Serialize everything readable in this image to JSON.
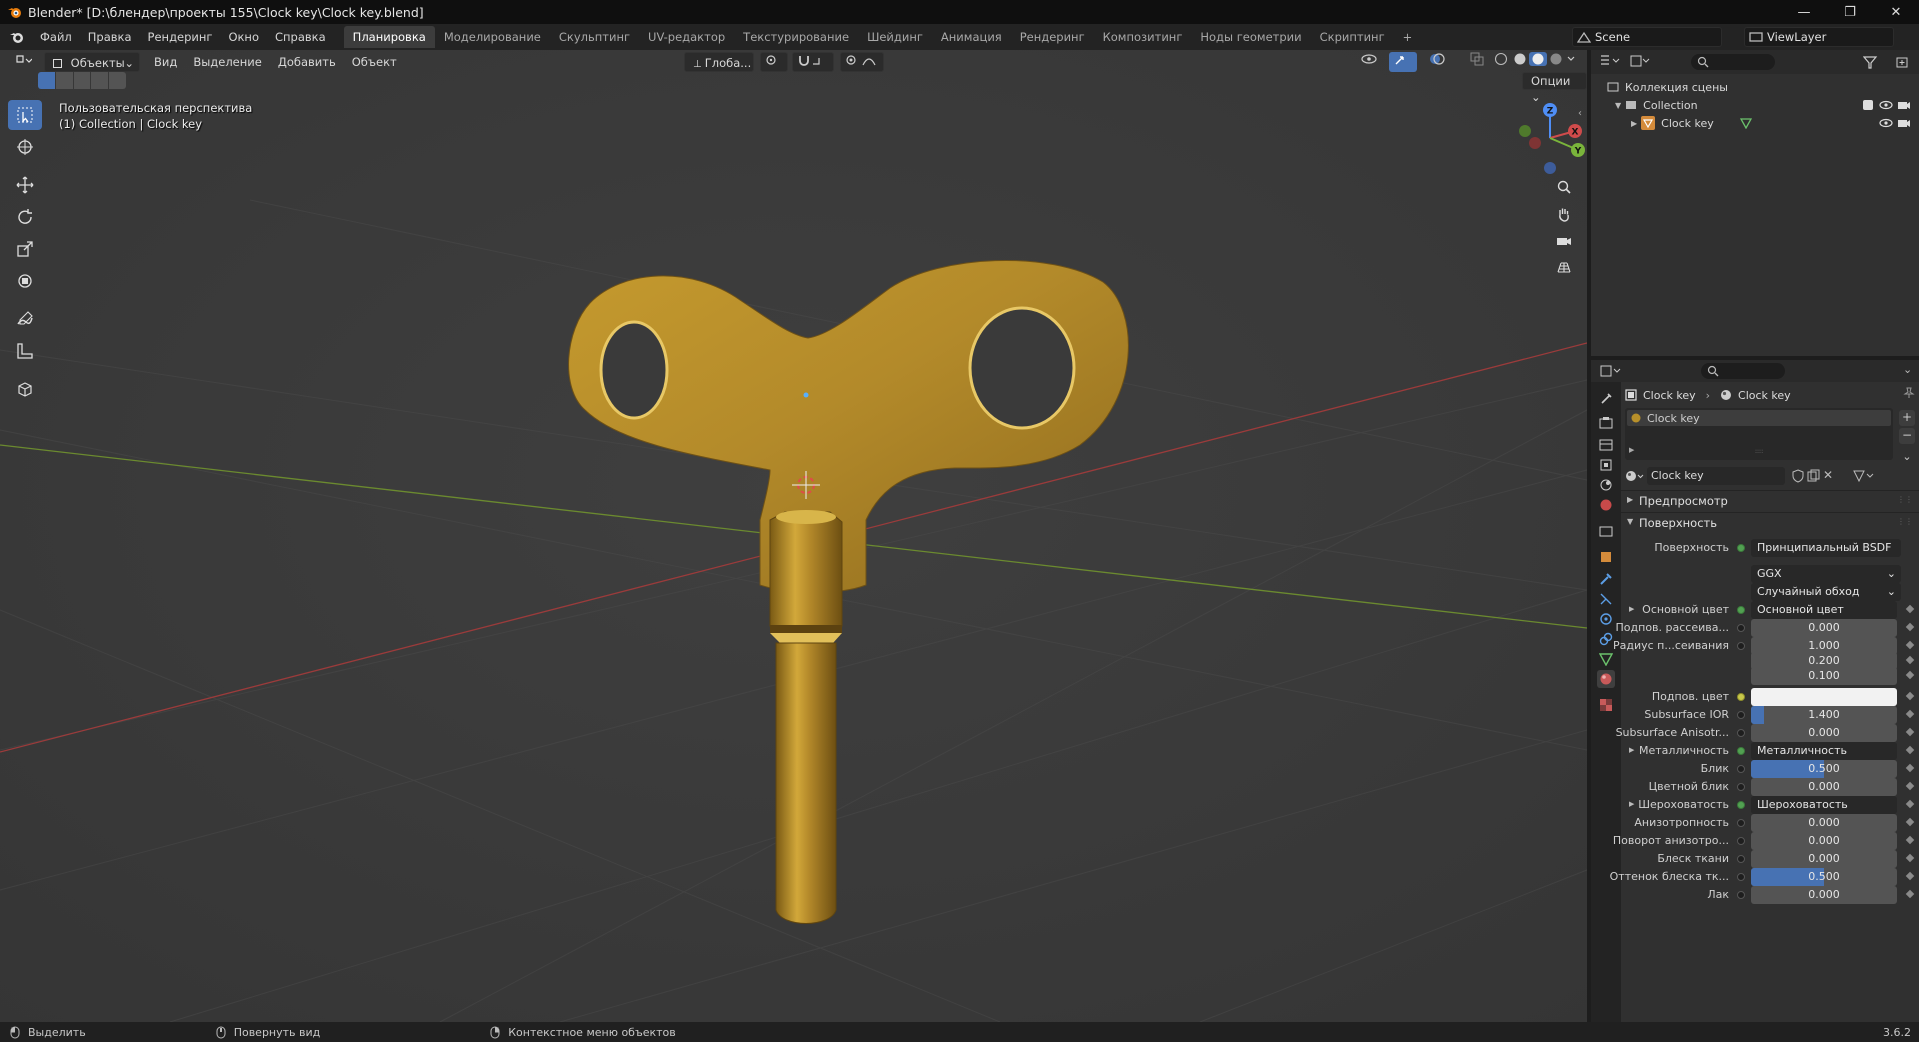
{
  "window": {
    "title": "Blender* [D:\\блендер\\проекты 155\\Clock key\\Clock key.blend]",
    "minimize": "—",
    "maximize": "❐",
    "close": "✕"
  },
  "menus": [
    "Файл",
    "Правка",
    "Рендеринг",
    "Окно",
    "Справка"
  ],
  "workspaces": [
    {
      "label": "Планировка",
      "active": true
    },
    {
      "label": "Моделирование"
    },
    {
      "label": "Скульптинг"
    },
    {
      "label": "UV-редактор"
    },
    {
      "label": "Текстурирование"
    },
    {
      "label": "Шейдинг"
    },
    {
      "label": "Анимация"
    },
    {
      "label": "Рендеринг"
    },
    {
      "label": "Композитинг"
    },
    {
      "label": "Ноды геометрии"
    },
    {
      "label": "Скриптинг"
    }
  ],
  "add_workspace": "+",
  "scene": {
    "name": "Scene",
    "view_layer": "ViewLayer"
  },
  "viewport": {
    "mode": "Объекты",
    "menus": [
      "Вид",
      "Выделение",
      "Добавить",
      "Объект"
    ],
    "transform_orientation": "Глоба...",
    "options_label": "Опции",
    "overlay_title": "Пользовательская перспектива",
    "overlay_subtitle": "(1) Collection | Clock key",
    "gizmo_labels": {
      "z": "Z",
      "y": "Y",
      "x": "X"
    }
  },
  "outliner": {
    "root": "Коллекция сцены",
    "collection": "Collection",
    "object": "Clock key"
  },
  "properties": {
    "breadcrumb_object": "Clock key",
    "breadcrumb_material": "Clock key",
    "slot": "Clock key",
    "material_name": "Clock key",
    "panel_preview": "Предпросмотр",
    "panel_surface": "Поверхность",
    "surface_label": "Поверхность",
    "surface_value": "Принципиальный BSDF",
    "distribution": "GGX",
    "subsurface_method": "Случайный обход",
    "rows": [
      {
        "label": "Основной цвет",
        "value": "Основной цвет",
        "kind": "link",
        "expand": true
      },
      {
        "label": "Подпов. рассеива...",
        "value": "0.000",
        "kind": "num",
        "fill": 0
      },
      {
        "label": "Радиус п...сеивания",
        "value": "1.000",
        "kind": "num",
        "fill": 0
      },
      {
        "label": "",
        "value": "0.200",
        "kind": "num",
        "fill": 0
      },
      {
        "label": "",
        "value": "0.100",
        "kind": "num",
        "fill": 0
      },
      {
        "label": "Подпов. цвет",
        "value": "",
        "kind": "color"
      },
      {
        "label": "Subsurface IOR",
        "value": "1.400",
        "kind": "num",
        "fill": 0.09
      },
      {
        "label": "Subsurface Anisotr...",
        "value": "0.000",
        "kind": "num",
        "fill": 0
      },
      {
        "label": "Металличность",
        "value": "Металличность",
        "kind": "link",
        "expand": true
      },
      {
        "label": "Блик",
        "value": "0.500",
        "kind": "num",
        "fill": 0.5
      },
      {
        "label": "Цветной блик",
        "value": "0.000",
        "kind": "num",
        "fill": 0
      },
      {
        "label": "Шероховатость",
        "value": "Шероховатость",
        "kind": "link",
        "expand": true
      },
      {
        "label": "Анизотропность",
        "value": "0.000",
        "kind": "num",
        "fill": 0
      },
      {
        "label": "Поворот анизотро...",
        "value": "0.000",
        "kind": "num",
        "fill": 0
      },
      {
        "label": "Блеск ткани",
        "value": "0.000",
        "kind": "num",
        "fill": 0
      },
      {
        "label": "Оттенок блеска тк...",
        "value": "0.500",
        "kind": "num",
        "fill": 0.5
      },
      {
        "label": "Лак",
        "value": "0.000",
        "kind": "num",
        "fill": 0
      }
    ]
  },
  "status": {
    "select": "Выделить",
    "rotate": "Повернуть вид",
    "context": "Контекстное меню объектов",
    "version": "3.6.2"
  },
  "colors": {
    "accent": "#4772b3",
    "brass": "#b8902a",
    "viewport_bg": "#393939"
  }
}
